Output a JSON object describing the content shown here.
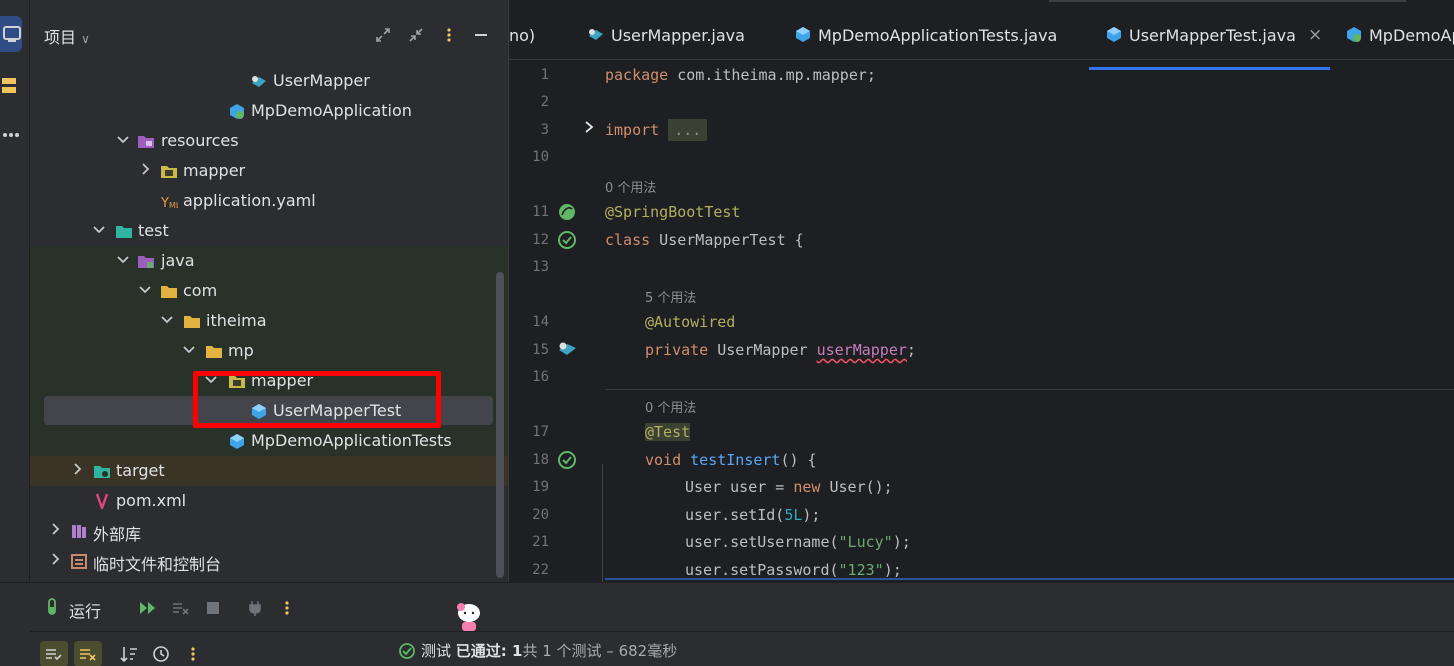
{
  "project_panel": {
    "title": "项目",
    "tree": [
      {
        "label": "UserMapper",
        "icon": "mapper-interface-icon"
      },
      {
        "label": "MpDemoApplication",
        "icon": "spring-class-icon"
      },
      {
        "label": "resources",
        "icon": "resources-folder-icon",
        "expanded": true
      },
      {
        "label": "mapper",
        "icon": "package-folder-icon",
        "expanded": false
      },
      {
        "label": "application.yaml",
        "icon": "yaml-icon"
      },
      {
        "label": "test",
        "icon": "test-folder-icon",
        "expanded": true
      },
      {
        "label": "java",
        "icon": "test-source-folder-icon",
        "expanded": true
      },
      {
        "label": "com",
        "icon": "folder-icon",
        "expanded": true
      },
      {
        "label": "itheima",
        "icon": "folder-icon",
        "expanded": true
      },
      {
        "label": "mp",
        "icon": "folder-icon",
        "expanded": true
      },
      {
        "label": "mapper",
        "icon": "package-folder-icon",
        "expanded": true
      },
      {
        "label": "UserMapperTest",
        "icon": "test-class-icon",
        "selected": true
      },
      {
        "label": "MpDemoApplicationTests",
        "icon": "test-class-icon"
      },
      {
        "label": "target",
        "icon": "excluded-folder-icon",
        "expanded": false
      },
      {
        "label": "pom.xml",
        "icon": "maven-icon"
      },
      {
        "label": "外部库",
        "icon": "library-icon",
        "expanded": false
      },
      {
        "label": "临时文件和控制台",
        "icon": "scratch-icon",
        "expanded": false
      }
    ]
  },
  "tabs": [
    {
      "label": "no)"
    },
    {
      "label": "UserMapper.java",
      "icon": "mapper-interface-icon"
    },
    {
      "label": "MpDemoApplicationTests.java",
      "icon": "test-class-icon"
    },
    {
      "label": "UserMapperTest.java",
      "icon": "test-class-icon",
      "active": true,
      "close": "×"
    },
    {
      "label": "MpDemoAp",
      "icon": "spring-class-icon"
    }
  ],
  "editor": {
    "line_numbers": [
      "1",
      "2",
      "3",
      "10",
      "11",
      "12",
      "13",
      "14",
      "15",
      "16",
      "17",
      "18",
      "19",
      "20",
      "21",
      "22"
    ],
    "usage_hints": [
      "0 个用法",
      "5 个用法",
      "0 个用法"
    ],
    "code": {
      "l1_kw": "package",
      "l1_rest": " com.itheima.mp.mapper;",
      "l3_kw": "import",
      "l3_fold": "...",
      "l11": "@SpringBootTest",
      "l12_kw": "class",
      "l12_rest": " UserMapperTest {",
      "l14": "@Autowired",
      "l15_kw": "private",
      "l15_type": " UserMapper ",
      "l15_field": "userMapper",
      "l15_end": ";",
      "l17": "@Test",
      "l18_kw": "void",
      "l18_fn": " testInsert",
      "l18_end": "() {",
      "l19_a": "User user = ",
      "l19_kw": "new",
      "l19_b": " User();",
      "l20_a": "user.setId(",
      "l20_num": "5L",
      "l20_b": ");",
      "l21_a": "user.setUsername(",
      "l21_str": "\"Lucy\"",
      "l21_b": ");",
      "l22_a": "user.setPassword(",
      "l22_str": "\"123\"",
      "l22_b": ");"
    }
  },
  "run_panel": {
    "title": "运行",
    "status_prefix": "测试",
    "status_passed": "已通过: 1",
    "status_rest": "共 1 个测试 – 682毫秒"
  },
  "colors": {
    "accent": "#3574f0",
    "pass_green": "#5fb865",
    "highlight_red": "#ff0000"
  }
}
